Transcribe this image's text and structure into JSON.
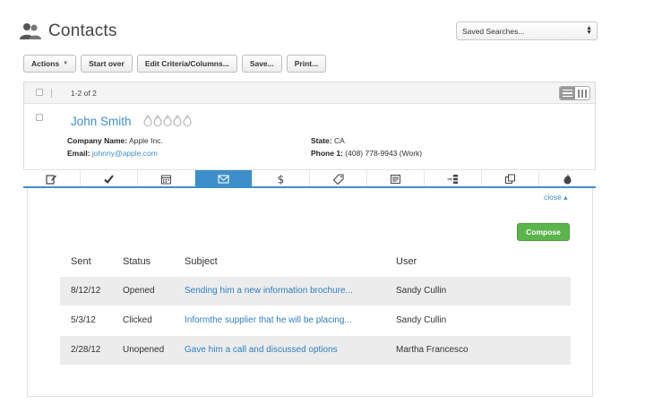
{
  "header": {
    "title": "Contacts"
  },
  "saved_searches": {
    "value": "Saved Searches..."
  },
  "toolbar": {
    "actions": "Actions",
    "start_over": "Start over",
    "edit_criteria": "Edit Criteria/Columns...",
    "save": "Save...",
    "print": "Print..."
  },
  "results": {
    "count": "1-2 of 2"
  },
  "contact": {
    "name": "John Smith",
    "rating": 5,
    "company_label": "Company Name:",
    "company": "Apple Inc.",
    "email_label": "Email:",
    "email": "johnny@apple.com",
    "state_label": "State:",
    "state": "CA",
    "phone_label": "Phone 1:",
    "phone": "(408) 778-9943 (Work)"
  },
  "tabs": [
    {
      "icon": "edit-icon"
    },
    {
      "icon": "check-icon"
    },
    {
      "icon": "calendar-icon"
    },
    {
      "icon": "email-icon",
      "active": true
    },
    {
      "icon": "dollar-icon"
    },
    {
      "icon": "tag-icon"
    },
    {
      "icon": "notes-icon"
    },
    {
      "icon": "sequence-icon"
    },
    {
      "icon": "copy-icon"
    },
    {
      "icon": "flame-icon"
    }
  ],
  "email_panel": {
    "close": "close ▴",
    "compose": "Compose",
    "columns": [
      "Sent",
      "Status",
      "Subject",
      "User"
    ],
    "rows": [
      {
        "sent": "8/12/12",
        "status": "Opened",
        "subject": "Sending him a new information brochure...",
        "user": "Sandy Cullin"
      },
      {
        "sent": "5/3/12",
        "status": "Clicked",
        "subject": "Informthe supplier that he will be placing...",
        "user": "Sandy Cullin"
      },
      {
        "sent": "2/28/12",
        "status": "Unopened",
        "subject": "Gave him a call and discussed options",
        "user": "Martha Francesco"
      }
    ]
  },
  "colors": {
    "accent": "#3d8fc9",
    "compose": "#5bb44c"
  }
}
